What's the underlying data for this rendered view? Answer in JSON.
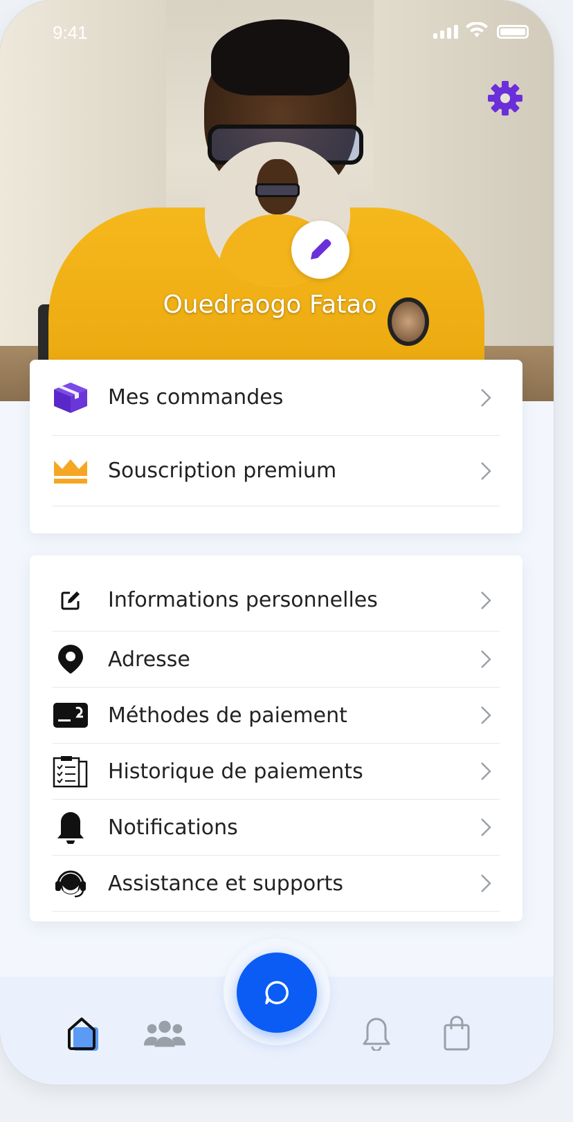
{
  "status_bar": {
    "time": "9:41"
  },
  "profile": {
    "name": "Ouedraogo Fatao"
  },
  "menu_primary": [
    {
      "label": "Mes commandes",
      "icon": "package-icon"
    },
    {
      "label": "Souscription premium",
      "icon": "crown-icon"
    }
  ],
  "menu_secondary": [
    {
      "label": "Informations personnelles",
      "icon": "edit-square-icon"
    },
    {
      "label": "Adresse",
      "icon": "location-pin-icon"
    },
    {
      "label": "Méthodes de paiement",
      "icon": "payment-card-icon"
    },
    {
      "label": "Historique de paiements",
      "icon": "clipboard-list-icon"
    },
    {
      "label": "Notifications",
      "icon": "bell-icon"
    },
    {
      "label": "Assistance et supports",
      "icon": "headset-icon"
    }
  ],
  "bottom_nav": [
    {
      "icon": "home-icon",
      "active": true
    },
    {
      "icon": "users-icon",
      "active": false
    },
    {
      "icon": "chat-icon",
      "active": false
    },
    {
      "icon": "bell-icon",
      "active": false
    },
    {
      "icon": "shopping-bag-icon",
      "active": false
    }
  ],
  "colors": {
    "accent": "#0a5cf5",
    "purple": "#6a2fd9",
    "gold": "#f5a623",
    "nav_bg": "#eaf1fc"
  }
}
